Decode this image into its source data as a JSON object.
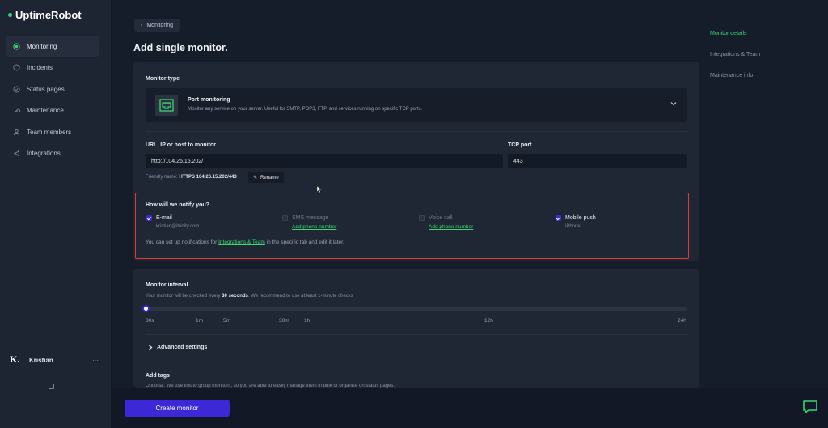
{
  "app": {
    "name": "UptimeRobot",
    "brand_color": "#3bd671",
    "accent_color": "#3c28d6"
  },
  "sidebar": {
    "items": [
      {
        "label": "Monitoring",
        "icon": "monitoring-icon",
        "active": true
      },
      {
        "label": "Incidents",
        "icon": "incidents-icon"
      },
      {
        "label": "Status pages",
        "icon": "status-pages-icon"
      },
      {
        "label": "Maintenance",
        "icon": "wrench-icon"
      },
      {
        "label": "Team members",
        "icon": "team-icon"
      },
      {
        "label": "Integrations",
        "icon": "share-icon"
      }
    ],
    "user": {
      "initial": "K.",
      "name": "Kristian",
      "more": "···"
    }
  },
  "breadcrumb": {
    "label": "Monitoring"
  },
  "page": {
    "title": "Add single monitor."
  },
  "monitor_type": {
    "label": "Monitor type",
    "selected_title": "Port monitoring",
    "selected_desc": "Monitor any service on your server. Useful for SMTP, POP3, FTP, and services running on specific TCP ports."
  },
  "url_field": {
    "label": "URL, IP or host to monitor",
    "value": "http://104.26.15.202/"
  },
  "port_field": {
    "label": "TCP port",
    "value": "443"
  },
  "friendly_name": {
    "prefix": "Friendly name:",
    "value": "HTTPS 104.26.15.202/443",
    "rename_label": "Rename"
  },
  "notify": {
    "title": "How will we notify you?",
    "options": [
      {
        "label": "E-mail",
        "checked": true,
        "sub": "kristian@itrinity.com"
      },
      {
        "label": "SMS message",
        "checked": false,
        "link": "Add phone number"
      },
      {
        "label": "Voice call",
        "checked": false,
        "link": "Add phone number"
      },
      {
        "label": "Mobile push",
        "checked": true,
        "sub": "iPhone"
      }
    ],
    "footer_pre": "You can set up notifications for",
    "footer_link": "Integrations & Team",
    "footer_post": "in the specific tab and edit it later."
  },
  "interval": {
    "label": "Monitor interval",
    "desc_pre": "Your monitor will be checked every",
    "desc_bold": "30 seconds",
    "desc_post": ". We recommend to use at least 1-minute checks",
    "ticks": [
      "30s",
      "1m",
      "5m",
      "30m",
      "1h",
      "12h",
      "24h"
    ],
    "value_fraction": 0
  },
  "advanced": {
    "label": "Advanced settings"
  },
  "tags": {
    "label": "Add tags",
    "desc": "Optional. We use this to group monitors, so you are able to easily manage them in bulk or organize on status pages."
  },
  "right_nav": {
    "items": [
      "Monitor details",
      "Integrations & Team",
      "Maintenance info"
    ],
    "active_index": 0
  },
  "create_button": {
    "label": "Create monitor"
  }
}
